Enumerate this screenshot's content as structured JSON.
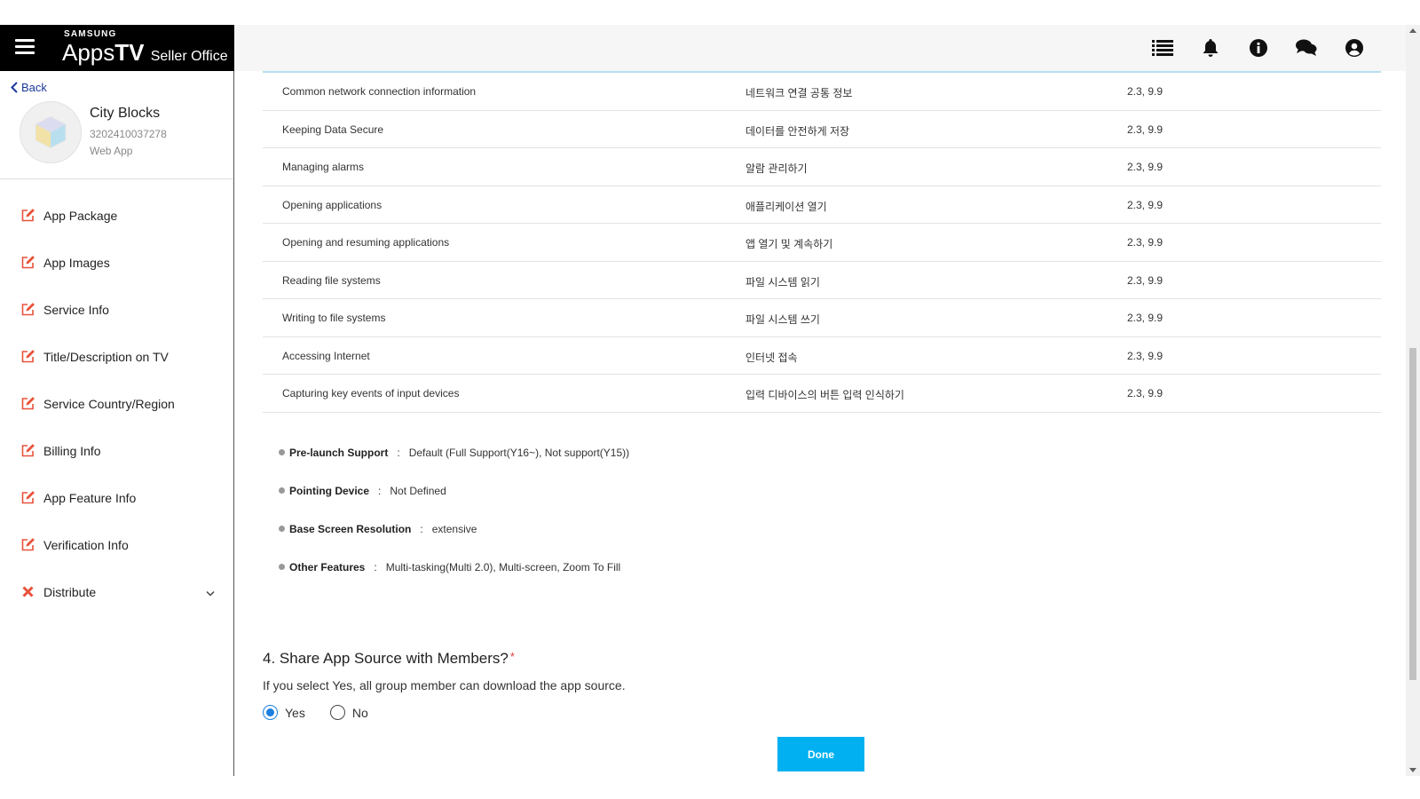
{
  "brand": {
    "samsung": "SAMSUNG",
    "apps": "Apps",
    "tv": "TV",
    "seller_office": "Seller Office"
  },
  "header_icons": [
    "list-icon",
    "bell-icon",
    "info-icon",
    "chat-icon",
    "user-icon"
  ],
  "sidebar": {
    "back_label": "Back",
    "app": {
      "name": "City Blocks",
      "id": "3202410037278",
      "type": "Web App"
    },
    "items": [
      {
        "label": "App Package",
        "icon": "edit-icon"
      },
      {
        "label": "App Images",
        "icon": "edit-icon"
      },
      {
        "label": "Service Info",
        "icon": "edit-icon"
      },
      {
        "label": "Title/Description on TV",
        "icon": "edit-icon"
      },
      {
        "label": "Service Country/Region",
        "icon": "edit-icon"
      },
      {
        "label": "Billing Info",
        "icon": "edit-icon"
      },
      {
        "label": "App Feature Info",
        "icon": "edit-icon"
      },
      {
        "label": "Verification Info",
        "icon": "edit-icon"
      },
      {
        "label": "Distribute",
        "icon": "close-icon"
      }
    ]
  },
  "permissions": [
    {
      "en": "Common network connection information",
      "ko": "네트워크 연결 공통 정보",
      "ver": "2.3, 9.9"
    },
    {
      "en": "Keeping Data Secure",
      "ko": "데이터를 안전하게 저장",
      "ver": "2.3, 9.9"
    },
    {
      "en": "Managing alarms",
      "ko": "알람 관리하기",
      "ver": "2.3, 9.9"
    },
    {
      "en": "Opening applications",
      "ko": "애플리케이션 열기",
      "ver": "2.3, 9.9"
    },
    {
      "en": "Opening and resuming applications",
      "ko": "앱 열기 및 계속하기",
      "ver": "2.3, 9.9"
    },
    {
      "en": "Reading file systems",
      "ko": "파일 시스템 읽기",
      "ver": "2.3, 9.9"
    },
    {
      "en": "Writing to file systems",
      "ko": "파일 시스템 쓰기",
      "ver": "2.3, 9.9"
    },
    {
      "en": "Accessing Internet",
      "ko": "인터넷 접속",
      "ver": "2.3, 9.9"
    },
    {
      "en": "Capturing key events of input devices",
      "ko": "입력 디바이스의 버튼 입력 인식하기",
      "ver": "2.3, 9.9"
    }
  ],
  "features": [
    {
      "key": "Pre-launch Support",
      "sep": ":",
      "value": "Default (Full Support(Y16~), Not support(Y15))"
    },
    {
      "key": "Pointing Device",
      "sep": ":",
      "value": "Not Defined"
    },
    {
      "key": "Base Screen Resolution",
      "sep": ":",
      "value": "extensive"
    },
    {
      "key": "Other Features",
      "sep": ":",
      "value": "Multi-tasking(Multi 2.0), Multi-screen, Zoom To Fill"
    }
  ],
  "share": {
    "title": "4. Share App Source with Members?",
    "required_mark": "*",
    "description": "If you select Yes, all group member can download the app source.",
    "options": [
      {
        "label": "Yes",
        "selected": true
      },
      {
        "label": "No",
        "selected": false
      }
    ]
  },
  "done_label": "Done",
  "colors": {
    "accent": "#00b0f0",
    "edit_icon": "#e8523a",
    "radio_selected": "#1a7fe0",
    "table_top_border": "#b7dff0"
  }
}
